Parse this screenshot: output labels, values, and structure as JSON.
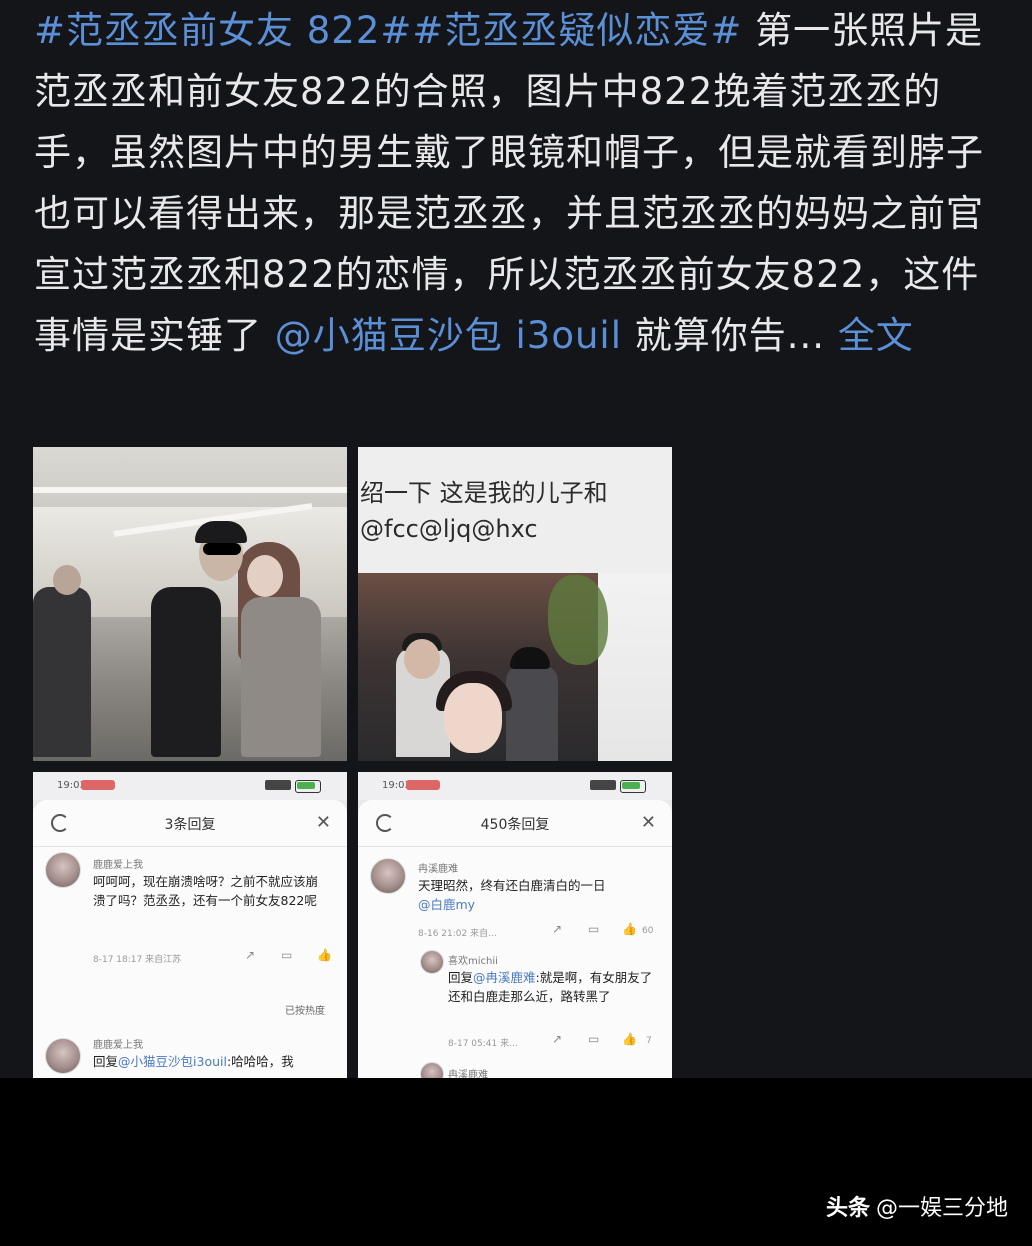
{
  "post": {
    "hashtag1": "#范丞丞前女友 822#",
    "hashtag2": "#范丞丞疑似恋爱#",
    "body": " 第一张照片是范丞丞和前女友822的合照，图片中822挽着范丞丞的手，虽然图片中的男生戴了眼镜和帽子，但是就看到脖子也可以看得出来，那是范丞丞，并且范丞丞的妈妈之前官宣过范丞丞和822的恋情，所以范丞丞前女友822，这件事情是实锤了 ",
    "mention": "@小猫豆沙包 i3ouil",
    "tail": " 就算你告... ",
    "fulltext_label": "全文"
  },
  "image2": {
    "line1": "绍一下 这是我的儿子和",
    "line2": "@fcc@ljq@hxc"
  },
  "shot1": {
    "time": "19:03",
    "title": "3条回复",
    "c1_user": "鹿鹿爱上我",
    "c1_text": "呵呵呵，现在崩溃啥呀？之前不就应该崩溃了吗？范丞丞，还有一个前女友822呢",
    "c1_meta": "8-17 18:17 来自江苏",
    "seemore": "已按热度",
    "c2_user": "鹿鹿爱上我",
    "c2_reply": "回复",
    "c2_mention": "@小猫豆沙包i3ouil",
    "c2_text": ":哈哈哈，我"
  },
  "shot2": {
    "time": "19:03",
    "title": "450条回复",
    "c1_user": "冉溪鹿难",
    "c1_text": "天理昭然，终有还白鹿清白的一日",
    "c1_mention": "@白鹿my",
    "c1_meta": "8-16 21:02 来自…",
    "c1_likes": "60",
    "c2_user": "喜欢michii",
    "c2_reply": "回复",
    "c2_mention": "@冉溪鹿难",
    "c2_text": ":就是啊，有女朋友了还和白鹿走那么近，路转黑了",
    "c2_meta": "8-17 05:41 来…",
    "c2_likes": "7",
    "c3_user": "冉溪鹿难"
  },
  "watermark": {
    "brand": "头条",
    "account": "@一娱三分地"
  },
  "colors": {
    "background": "#141519",
    "link": "#5b8fd6",
    "footer": "#000000"
  }
}
